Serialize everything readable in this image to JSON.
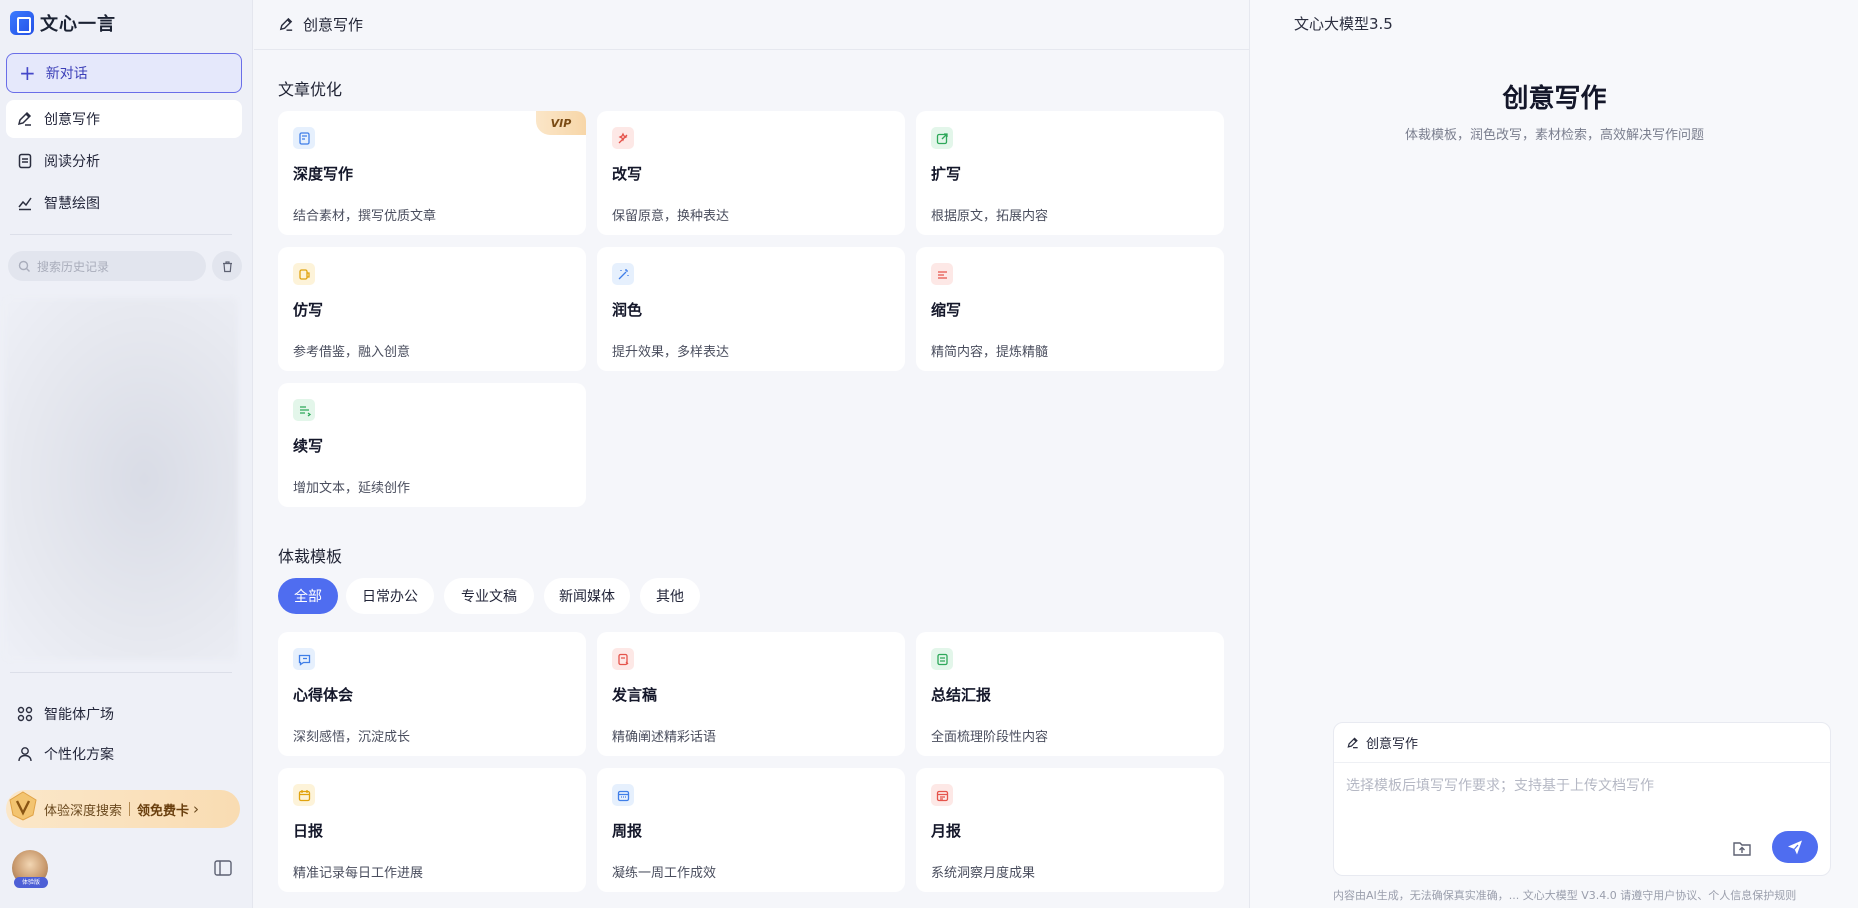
{
  "app": {
    "name": "文心一言"
  },
  "sidebar": {
    "new_chat": "新对话",
    "nav": [
      {
        "label": "创意写作",
        "icon": "pen-icon",
        "active": true
      },
      {
        "label": "阅读分析",
        "icon": "document-icon",
        "active": false
      },
      {
        "label": "智慧绘图",
        "icon": "draw-icon",
        "active": false
      }
    ],
    "search_placeholder": "搜索历史记录",
    "bottom_nav": [
      {
        "label": "智能体广场",
        "icon": "grid-icon"
      },
      {
        "label": "个性化方案",
        "icon": "user-icon"
      }
    ],
    "promo": {
      "text": "体验深度搜索",
      "cta": "领免费卡",
      "arrow": "›"
    },
    "avatar_tag": "体验版"
  },
  "main": {
    "header_title": "创意写作",
    "section1_title": "文章优化",
    "optimize_cards": [
      {
        "title": "深度写作",
        "desc": "结合素材，撰写优质文章",
        "icon": "doc-edit-icon",
        "color": "#3f7ee8",
        "bg": "#e6f0fd",
        "badge": "VIP"
      },
      {
        "title": "改写",
        "desc": "保留原意，换种表达",
        "icon": "rewrite-icon",
        "color": "#e5534b",
        "bg": "#fde8e6"
      },
      {
        "title": "扩写",
        "desc": "根据原文，拓展内容",
        "icon": "expand-icon",
        "color": "#2ea85a",
        "bg": "#e3f6ea"
      },
      {
        "title": "仿写",
        "desc": "参考借鉴，融入创意",
        "icon": "imitate-icon",
        "color": "#e0a20e",
        "bg": "#fdf3d9"
      },
      {
        "title": "润色",
        "desc": "提升效果，多样表达",
        "icon": "magic-wand-icon",
        "color": "#3f7ee8",
        "bg": "#e6f0fd"
      },
      {
        "title": "缩写",
        "desc": "精简内容，提炼精髓",
        "icon": "shrink-icon",
        "color": "#e5534b",
        "bg": "#fde8e6"
      },
      {
        "title": "续写",
        "desc": "增加文本，延续创作",
        "icon": "continue-icon",
        "color": "#2ea85a",
        "bg": "#e3f6ea"
      }
    ],
    "section2_title": "体裁模板",
    "filter_chips": [
      {
        "label": "全部",
        "active": true
      },
      {
        "label": "日常办公",
        "active": false
      },
      {
        "label": "专业文稿",
        "active": false
      },
      {
        "label": "新闻媒体",
        "active": false
      },
      {
        "label": "其他",
        "active": false
      }
    ],
    "template_cards": [
      {
        "title": "心得体会",
        "desc": "深刻感悟，沉淀成长",
        "icon": "chat-heart-icon",
        "color": "#3f7ee8",
        "bg": "#e6f0fd"
      },
      {
        "title": "发言稿",
        "desc": "精确阐述精彩话语",
        "icon": "speech-icon",
        "color": "#e5534b",
        "bg": "#fde8e6"
      },
      {
        "title": "总结汇报",
        "desc": "全面梳理阶段性内容",
        "icon": "report-icon",
        "color": "#2ea85a",
        "bg": "#e3f6ea"
      },
      {
        "title": "日报",
        "desc": "精准记录每日工作进展",
        "icon": "calendar-icon",
        "color": "#e0a20e",
        "bg": "#fdf3d9"
      },
      {
        "title": "周报",
        "desc": "凝练一周工作成效",
        "icon": "calendar-week-icon",
        "color": "#3f7ee8",
        "bg": "#e6f0fd"
      },
      {
        "title": "月报",
        "desc": "系统洞察月度成果",
        "icon": "calendar-month-icon",
        "color": "#e5534b",
        "bg": "#fde8e6"
      }
    ]
  },
  "right": {
    "model_name": "文心大模型3.5",
    "hero_title": "创意写作",
    "hero_subtitle": "体裁模板，润色改写，素材检索，高效解决写作问题",
    "composer_label": "创意写作",
    "composer_placeholder": "选择模板后填写写作要求；支持基于上传文档写作",
    "footnote": "内容由AI生成，无法确保真实准确，...   文心大模型 V3.4.0 请遵守用户协议、个人信息保护规则"
  }
}
